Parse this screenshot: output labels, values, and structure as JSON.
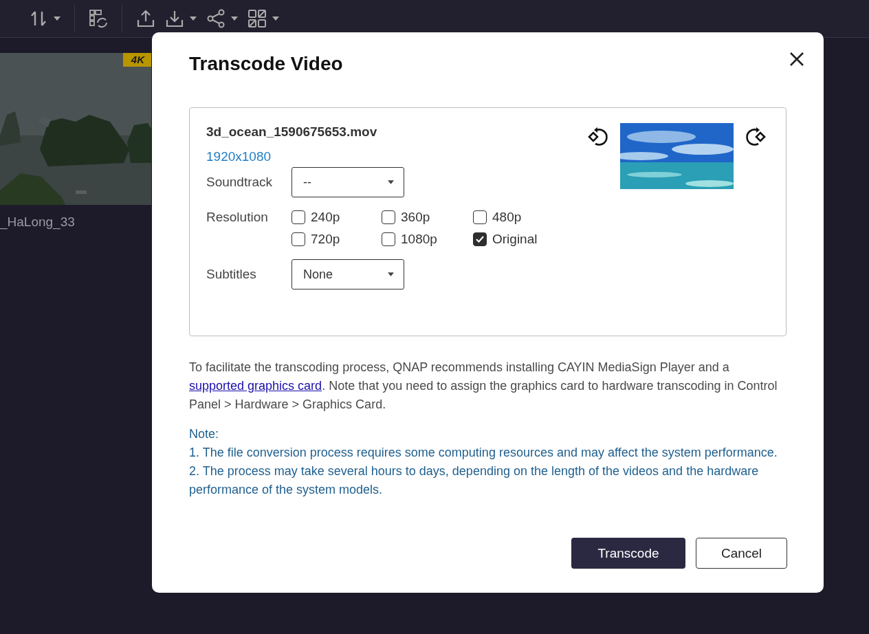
{
  "toolbar": {
    "groups": [
      {
        "buttons": [
          {
            "kind": "sort",
            "dropdown": true
          }
        ]
      },
      {
        "buttons": [
          {
            "kind": "refresh",
            "dropdown": false
          }
        ]
      },
      {
        "buttons": [
          {
            "kind": "upload",
            "dropdown": false
          },
          {
            "kind": "download",
            "dropdown": true
          },
          {
            "kind": "share",
            "dropdown": true
          },
          {
            "kind": "grid",
            "dropdown": true
          }
        ]
      }
    ]
  },
  "media_card": {
    "badge": "4K",
    "name": "_HaLong_33"
  },
  "dialog": {
    "title": "Transcode Video",
    "file": {
      "name": "3d_ocean_1590675653.mov",
      "resolution": "1920x1080"
    },
    "soundtrack": {
      "label": "Soundtrack",
      "value": "--"
    },
    "resolution": {
      "label": "Resolution",
      "options": [
        {
          "label": "240p",
          "checked": false
        },
        {
          "label": "360p",
          "checked": false
        },
        {
          "label": "480p",
          "checked": false
        },
        {
          "label": "720p",
          "checked": false
        },
        {
          "label": "1080p",
          "checked": false
        },
        {
          "label": "Original",
          "checked": true
        }
      ]
    },
    "subtitles": {
      "label": "Subtitles",
      "value": "None"
    },
    "info": {
      "before": "To facilitate the transcoding process, QNAP recommends installing CAYIN MediaSign Player and a ",
      "link": "supported graphics card",
      "after": ". Note that you need to assign the graphics card to hardware transcoding in Control Panel > Hardware > Graphics Card."
    },
    "note": {
      "title": "Note:",
      "items": [
        "1. The file conversion process requires some computing resources and may affect the system performance.",
        "2. The process may take several hours to days, depending on the length of the videos and the hardware performance of the system models."
      ]
    },
    "buttons": [
      {
        "label": "Transcode",
        "kind": "primary"
      },
      {
        "label": "Cancel",
        "kind": "secondary"
      }
    ]
  }
}
